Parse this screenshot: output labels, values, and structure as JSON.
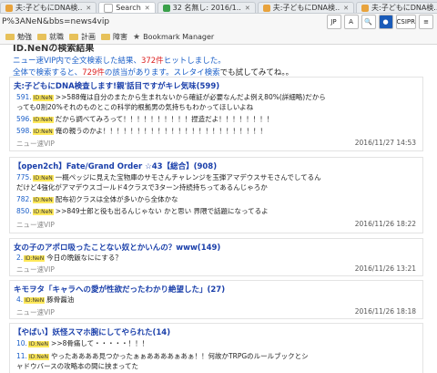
{
  "tabs": [
    {
      "label": "夫:子どもにDNA検..",
      "color": "#e8a33d"
    },
    {
      "label": "Search",
      "color": "#ffffff"
    },
    {
      "label": "32 名無し: 2016/1..",
      "color": "#3aa04a"
    },
    {
      "label": "夫:子どもにDNA検..",
      "color": "#e8a33d"
    },
    {
      "label": "夫:子どもにDNA検..",
      "color": "#e8a33d"
    }
  ],
  "url": "P%3ANeN&bbs=news4vip",
  "ext_labels": [
    "JP",
    "A",
    "CSIPR"
  ],
  "bookmarks": [
    "勉強",
    "就職",
    "計画",
    "障害",
    "Bookmark Manager"
  ],
  "header": {
    "title": "ID.NeNの検索結果",
    "line2_a": "ニュー速VIP内で全文検索した結果、",
    "line2_count": "372件",
    "line2_b": "ヒットしました。",
    "line3_a": "全体で検索する",
    "line3_b": "と、",
    "line3_count": "729件",
    "line3_c": "の該当があります。",
    "line3_d": "スレタイ検索",
    "line3_e": "でも試してみてね。。"
  },
  "threads": [
    {
      "title": "夫:子どもにDNA検査します!親'話目ですがキレ気味(599)",
      "posts": [
        {
          "num": "591.",
          "id": "ID:NeN",
          "text": ">>588俺は自分のまたから生まれないから確証が必要なんだよ例え80%(詳細略)だから"
        },
        {
          "num": "",
          "id": "",
          "text": "っても0割20%それのものとこの科学的根拠男の気持ちもわかってほしいよね"
        },
        {
          "num": "596.",
          "id": "ID:NeN",
          "text": "だから調べてみろって！！！！！！！！！！捏造だよ！！！！！！！！"
        },
        {
          "num": "598.",
          "id": "ID:NeN",
          "text": "俺の親うのかよ！！！！！！！！！！！！！！！！！！！！！！！！"
        }
      ],
      "source": "ニュー速VIP",
      "date": "2016/11/27 14:53"
    },
    {
      "title": "【open2ch】Fate/Grand Order ☆43【総合】(908)",
      "posts": [
        {
          "num": "775.",
          "id": "ID:NeN",
          "text": "一概ペッジに見えた宝物庫のサモさんチャレンジを玉弾アマデウスサモさんでしてるん"
        },
        {
          "num": "",
          "id": "",
          "text": "だけど4強化がアマデウスゴールド4クラスで3ターン持続持ちってあるんじゃろか"
        },
        {
          "num": "782.",
          "id": "ID:NeN",
          "text": "配布初クラスは全体が多いから全体かな"
        },
        {
          "num": "850.",
          "id": "ID:NeN",
          "text": ">>849士郎と役も出るんじゃない かと思い 界隈で話題になってるよ"
        }
      ],
      "source": "ニュー速VIP",
      "date": "2016/11/26 18:22"
    },
    {
      "title": "女の子のアポロ吸ったことない奴とかいんの？www(149)",
      "posts": [
        {
          "num": "2.",
          "id": "ID:NeN",
          "text": "今日の晩飯なににする？"
        }
      ],
      "source": "ニュー速VIP",
      "date": "2016/11/26 13:21"
    },
    {
      "title": "キモヲタ「キャラへの愛が性欲だったわかり絶望した」(27)",
      "posts": [
        {
          "num": "4.",
          "id": "ID:NeN",
          "text": "豚骨醤油"
        }
      ],
      "source": "ニュー速VIP",
      "date": "2016/11/26 18:18"
    },
    {
      "title": "【やばい】妖怪スマホ腕にしてやられた(14)",
      "posts": [
        {
          "num": "10.",
          "id": "ID:NeN",
          "text": ">>8骨痛して・・・・・！！！"
        },
        {
          "num": "11.",
          "id": "ID:NeN",
          "text": "やったああああ見つかったぁぁああああぁあぁ！！何故かTRPGのルールブックとシ"
        },
        {
          "num": "",
          "id": "",
          "text": "ャドウバースの攻略本の間に挟まってた"
        }
      ],
      "source": "",
      "date": ""
    }
  ]
}
